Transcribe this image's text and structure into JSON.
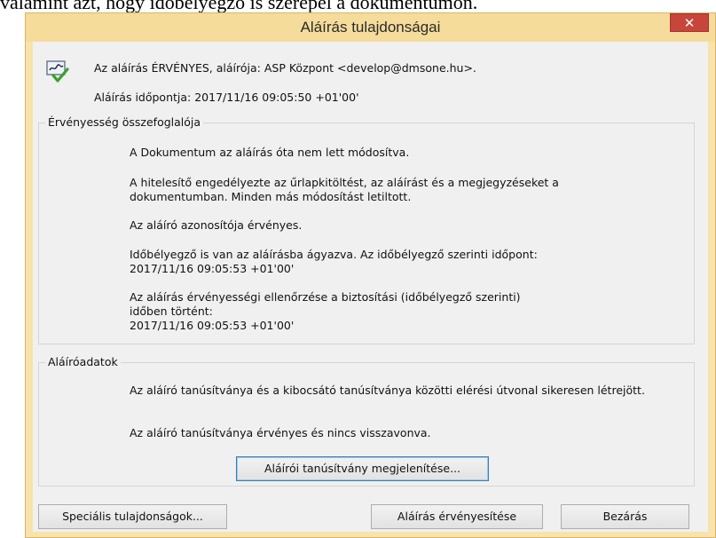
{
  "document": {
    "text_line": "valamint azt, hogy időbélyegző is szerepel a dokumentumon."
  },
  "window": {
    "title": "Aláírás tulajdonságai",
    "close_glyph": "✕"
  },
  "signature": {
    "icon": "signature-check-icon",
    "status_text": "Az aláírás ÉRVÉNYES, aláírója: ASP Központ <develop@dmsone.hu>.",
    "time_text": "Aláírás időpontja:  2017/11/16 09:05:50 +01'00'"
  },
  "validity": {
    "group_label": "Érvényesség összefoglalója",
    "items": [
      "A Dokumentum az aláírás óta nem lett módosítva.",
      "A hitelesítő engedélyezte az űrlapkitöltést, az aláírást és a megjegyzéseket a dokumentumban. Minden más módosítást letiltott.",
      "Az aláíró azonosítója érvényes.",
      "Időbélyegző is van az aláírásba ágyazva. Az időbélyegző szerinti időpont:\n2017/11/16 09:05:53 +01'00'",
      "Az aláírás érvényességi ellenőrzése a biztosítási (időbélyegző szerinti) időben történt:\n2017/11/16 09:05:53 +01'00'"
    ]
  },
  "signer": {
    "group_label": "Aláíróadatok",
    "items": [
      "Az aláíró tanúsítványa és a kibocsátó tanúsítványa közötti elérési útvonal sikeresen létrejött.",
      "Az aláíró tanúsítványa érvényes és nincs visszavonva."
    ],
    "show_cert_button": "Aláírói tanúsítvány megjelenítése..."
  },
  "footer": {
    "special_props_button": "Speciális tulajdonságok...",
    "validate_button": "Aláírás érvényesítése",
    "close_button": "Bezárás"
  },
  "colors": {
    "titlebar": "#f5dc9a",
    "close_button": "#c7453b",
    "dialog_bg": "#f0f0f0"
  }
}
